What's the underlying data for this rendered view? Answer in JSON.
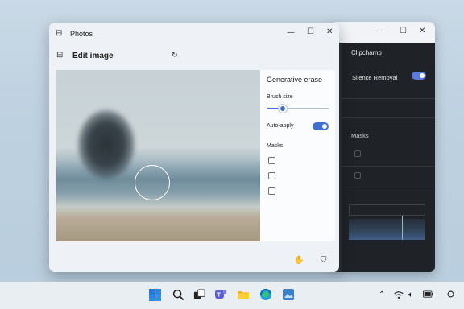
{
  "photos": {
    "title": "Photos",
    "header": "Edit image",
    "controls": {
      "minimize": "—",
      "maximize": "☐",
      "close": "✕"
    }
  },
  "edit_panel": {
    "title": "Generative erase",
    "brush_size_label": "Brush size",
    "brush_size_level": 0.25,
    "auto_apply_label": "Auto-apply",
    "auto_apply_on": true,
    "masks_label": "Masks"
  },
  "clipchamp": {
    "title": "Clipchamp",
    "silence_label": "Silence Removal",
    "silence_on": true,
    "masks_label": "Masks",
    "controls": {
      "minimize": "—",
      "maximize": "☐",
      "close": "✕"
    }
  },
  "colors": {
    "accent": "#3f6fd1",
    "dark_bg": "#2b2f36"
  },
  "taskbar": {
    "icons": [
      "windows-start-icon",
      "search-icon",
      "task-view-icon",
      "teams-icon",
      "file-explorer-icon",
      "edge-icon",
      "photos-app-icon"
    ],
    "tray_icons": [
      "chevron-up-icon",
      "wifi-icon",
      "volume-icon",
      "battery-icon",
      "notification-icon"
    ]
  }
}
